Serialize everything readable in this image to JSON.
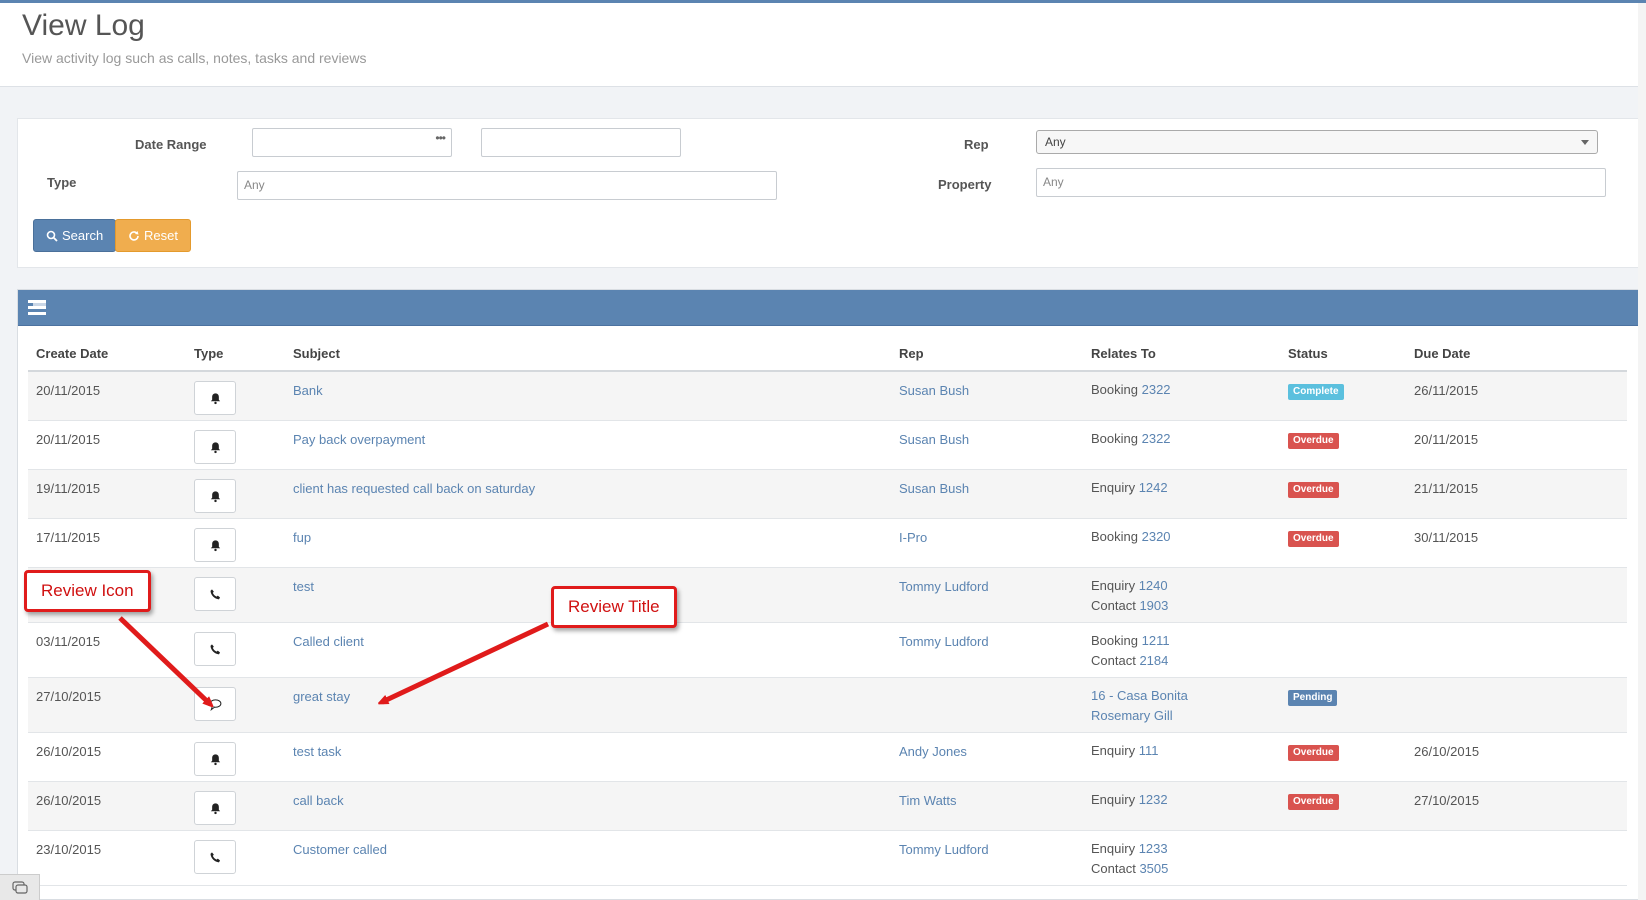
{
  "page": {
    "title": "View Log",
    "subtitle": "View activity log such as calls, notes, tasks and reviews"
  },
  "filters": {
    "date_range_label": "Date Range",
    "date_from_value": "",
    "date_to_value": "",
    "date_picker_dots": "•••",
    "rep_label": "Rep",
    "rep_selected": "Any",
    "type_label": "Type",
    "type_placeholder": "Any",
    "property_label": "Property",
    "property_placeholder": "Any",
    "search_label": "Search",
    "reset_label": "Reset"
  },
  "table": {
    "columns": [
      "Create Date",
      "Type",
      "Subject",
      "Rep",
      "Relates To",
      "Status",
      "Due Date"
    ],
    "rows": [
      {
        "create_date": "20/11/2015",
        "type_icon": "bell-icon",
        "subject": "Bank",
        "rep": "Susan Bush",
        "relates": [
          {
            "label": "Booking",
            "ref": "2322"
          }
        ],
        "status": "Complete",
        "status_color": "#5bc0de",
        "due_date": "26/11/2015"
      },
      {
        "create_date": "20/11/2015",
        "type_icon": "bell-icon",
        "subject": "Pay back overpayment",
        "rep": "Susan Bush",
        "relates": [
          {
            "label": "Booking",
            "ref": "2322"
          }
        ],
        "status": "Overdue",
        "status_color": "#d9534f",
        "due_date": "20/11/2015"
      },
      {
        "create_date": "19/11/2015",
        "type_icon": "bell-icon",
        "subject": "client has requested call back on saturday",
        "rep": "Susan Bush",
        "relates": [
          {
            "label": "Enquiry",
            "ref": "1242"
          }
        ],
        "status": "Overdue",
        "status_color": "#d9534f",
        "due_date": "21/11/2015"
      },
      {
        "create_date": "17/11/2015",
        "type_icon": "bell-icon",
        "subject": "fup",
        "rep": "I-Pro",
        "relates": [
          {
            "label": "Booking",
            "ref": "2320"
          }
        ],
        "status": "Overdue",
        "status_color": "#d9534f",
        "due_date": "30/11/2015"
      },
      {
        "create_date": "",
        "type_icon": "phone-icon",
        "subject": "test",
        "rep": "Tommy Ludford",
        "relates": [
          {
            "label": "Enquiry",
            "ref": "1240"
          },
          {
            "label": "Contact",
            "ref": "1903"
          }
        ],
        "status": "",
        "status_color": "",
        "due_date": ""
      },
      {
        "create_date": "03/11/2015",
        "type_icon": "phone-icon",
        "subject": "Called client",
        "rep": "Tommy Ludford",
        "relates": [
          {
            "label": "Booking",
            "ref": "1211"
          },
          {
            "label": "Contact",
            "ref": "2184"
          }
        ],
        "status": "",
        "status_color": "",
        "due_date": ""
      },
      {
        "create_date": "27/10/2015",
        "type_icon": "comment-icon",
        "subject": "great stay",
        "rep": "",
        "relates": [
          {
            "label": "",
            "ref": "16 - Casa Bonita"
          },
          {
            "label": "",
            "ref": "Rosemary Gill"
          }
        ],
        "status": "Pending",
        "status_color": "#5b84b1",
        "due_date": ""
      },
      {
        "create_date": "26/10/2015",
        "type_icon": "bell-icon",
        "subject": "test task",
        "rep": "Andy Jones",
        "relates": [
          {
            "label": "Enquiry",
            "ref": "111"
          }
        ],
        "status": "Overdue",
        "status_color": "#d9534f",
        "due_date": "26/10/2015"
      },
      {
        "create_date": "26/10/2015",
        "type_icon": "bell-icon",
        "subject": "call back",
        "rep": "Tim Watts",
        "relates": [
          {
            "label": "Enquiry",
            "ref": "1232"
          }
        ],
        "status": "Overdue",
        "status_color": "#d9534f",
        "due_date": "27/10/2015"
      },
      {
        "create_date": "23/10/2015",
        "type_icon": "phone-icon",
        "subject": "Customer called",
        "rep": "Tommy Ludford",
        "relates": [
          {
            "label": "Enquiry",
            "ref": "1233"
          },
          {
            "label": "Contact",
            "ref": "3505"
          }
        ],
        "status": "",
        "status_color": "",
        "due_date": ""
      }
    ]
  },
  "annotations": {
    "review_icon": "Review Icon",
    "review_title": "Review Title"
  },
  "colors": {
    "primary": "#5b84b1",
    "warning": "#f0ad4e",
    "danger": "#d9534f",
    "info": "#5bc0de",
    "callout": "#e01b1b"
  }
}
